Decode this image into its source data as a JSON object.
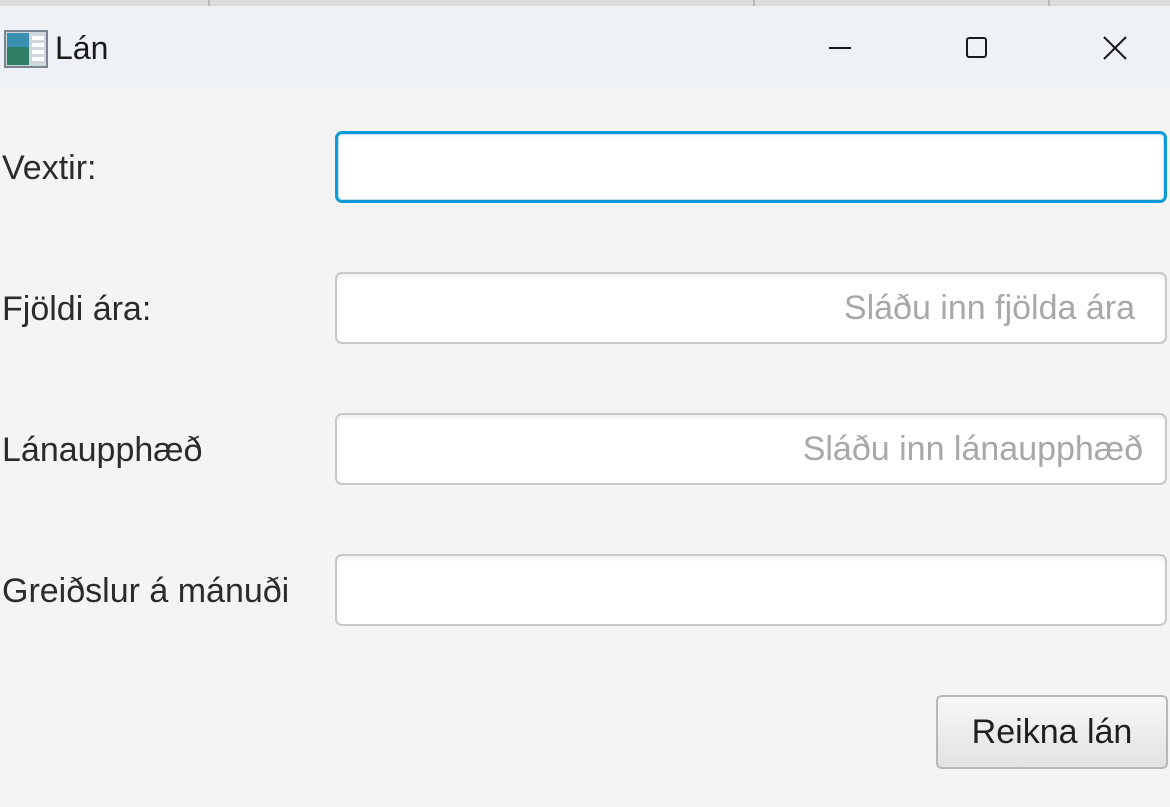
{
  "window": {
    "title": "Lán",
    "app_icon": "window-app-icon",
    "controls": {
      "minimize_icon": "minimize-icon",
      "maximize_icon": "maximize-icon",
      "close_icon": "close-icon"
    }
  },
  "form": {
    "fields": [
      {
        "label": "Vextir:",
        "value": "",
        "placeholder": "",
        "focused": true
      },
      {
        "label": "Fjöldi ára:",
        "value": "",
        "placeholder": "Sláðu inn fjölda ára",
        "focused": false
      },
      {
        "label": "Lánaupphæð",
        "value": "",
        "placeholder": "Sláðu inn lánaupphæð",
        "focused": false
      },
      {
        "label": "Greiðslur á mánuði",
        "value": "",
        "placeholder": "",
        "focused": false
      }
    ],
    "submit_label": "Reikna lán"
  },
  "colors": {
    "focus_border": "#0f9bd7",
    "titlebar_bg": "#eef2f7",
    "window_bg": "#f4f4f4"
  }
}
